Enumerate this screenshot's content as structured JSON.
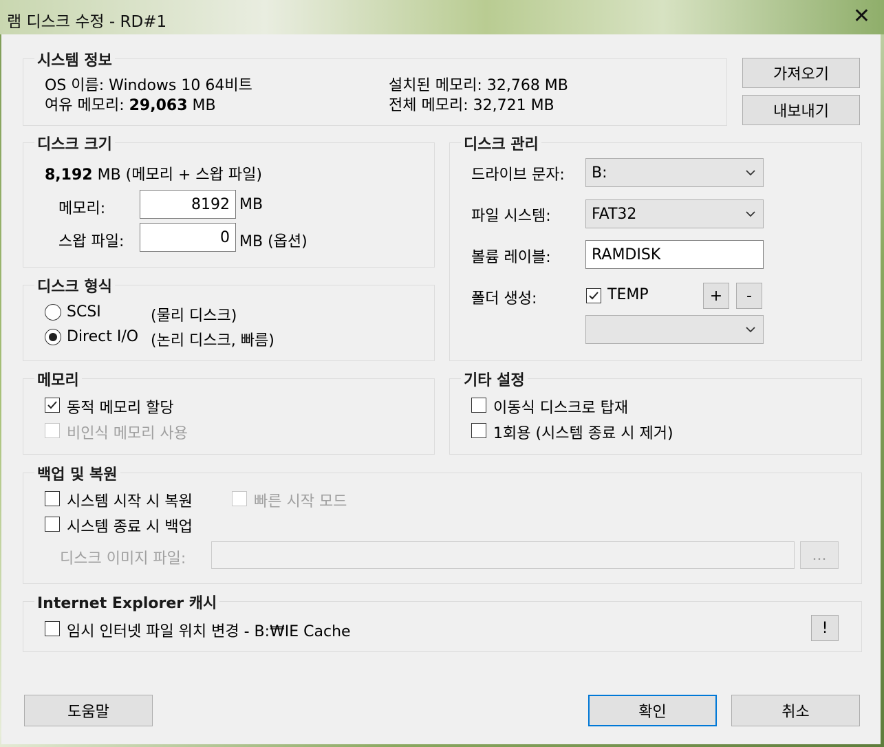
{
  "window": {
    "title": "램 디스크 수정 - RD#1"
  },
  "system_info": {
    "label": "시스템 정보",
    "os_label": "OS 이름:",
    "os_value": "Windows 10 64비트",
    "free_mem_label": "여유 메모리:",
    "free_mem_value": "29,063",
    "free_mem_unit": "MB",
    "installed_mem": "설치된 메모리: 32,768 MB",
    "total_mem": "전체 메모리: 32,721 MB"
  },
  "top_buttons": {
    "import": "가져오기",
    "export": "내보내기"
  },
  "disk_size": {
    "label": "디스크 크기",
    "total_value": "8,192",
    "total_suffix": "MB (메모리 + 스왑 파일)",
    "memory_label": "메모리:",
    "memory_value": "8192",
    "memory_unit": "MB",
    "swap_label": "스왑 파일:",
    "swap_value": "0",
    "swap_unit": "MB (옵션)"
  },
  "disk_type": {
    "label": "디스크 형식",
    "scsi": "SCSI",
    "scsi_desc": "(물리 디스크)",
    "directio": "Direct I/O",
    "directio_desc": "(논리 디스크, 빠름)",
    "selected": "Direct I/O"
  },
  "memory": {
    "label": "메모리",
    "dynamic": "동적 메모리 할당",
    "dynamic_checked": true,
    "nonpaged": "비인식 메모리 사용",
    "nonpaged_checked": false
  },
  "disk_manage": {
    "label": "디스크 관리",
    "drive_label": "드라이브 문자:",
    "drive_value": "B:",
    "fs_label": "파일 시스템:",
    "fs_value": "FAT32",
    "volume_label": "볼륨 레이블:",
    "volume_value": "RAMDISK",
    "folder_label": "폴더 생성:",
    "folder_name": "TEMP",
    "folder_checked": true,
    "add_btn": "+",
    "remove_btn": "-"
  },
  "other": {
    "label": "기타 설정",
    "removable": "이동식 디스크로 탑재",
    "removable_checked": false,
    "onetime": "1회용 (시스템 종료 시 제거)",
    "onetime_checked": false
  },
  "backup": {
    "label": "백업 및 복원",
    "restore_on_start": "시스템 시작 시 복원",
    "fast_start": "빠른 시작 모드",
    "backup_on_shutdown": "시스템 종료 시 백업",
    "image_label": "디스크 이미지 파일:",
    "image_value": "",
    "browse": "..."
  },
  "ie": {
    "label": "Internet Explorer 캐시",
    "change": "임시 인터넷 파일 위치 변경 - B:₩IE Cache",
    "info_btn": "!"
  },
  "footer": {
    "help": "도움말",
    "ok": "확인",
    "cancel": "취소"
  },
  "colors": {
    "accent": "#0078d7",
    "dialog_bg": "#f0f0f0"
  }
}
